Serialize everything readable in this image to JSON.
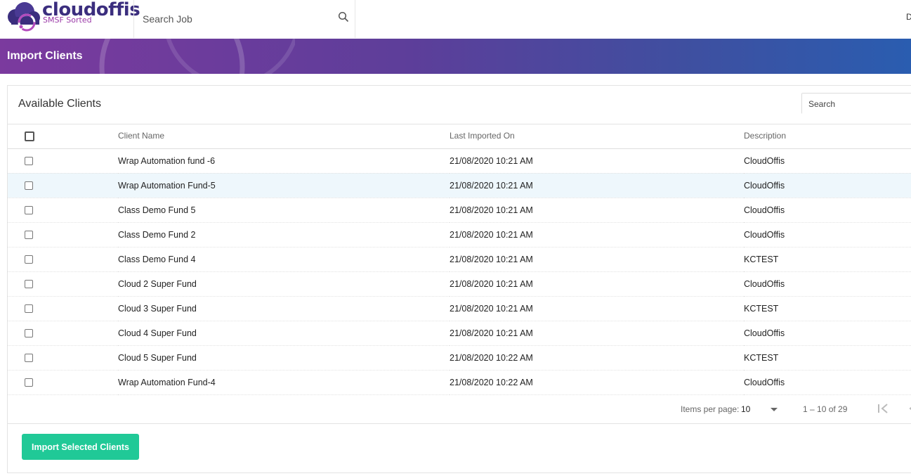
{
  "brand": {
    "name": "cloudoffis",
    "tagline": "SMSF Sorted"
  },
  "header": {
    "search_placeholder": "Search Job",
    "user_initial": "D"
  },
  "page": {
    "title": "Import Clients"
  },
  "card": {
    "title": "Available Clients",
    "search_placeholder": "Search"
  },
  "table": {
    "columns": [
      "",
      "Client Name",
      "Last Imported On",
      "Description"
    ],
    "rows": [
      {
        "name": "Wrap Automation fund -6",
        "date": "21/08/2020 10:21 AM",
        "desc": "CloudOffis"
      },
      {
        "name": "Wrap Automation Fund-5",
        "date": "21/08/2020 10:21 AM",
        "desc": "CloudOffis"
      },
      {
        "name": "Class Demo Fund 5",
        "date": "21/08/2020 10:21 AM",
        "desc": "CloudOffis"
      },
      {
        "name": "Class Demo Fund 2",
        "date": "21/08/2020 10:21 AM",
        "desc": "CloudOffis"
      },
      {
        "name": "Class Demo Fund 4",
        "date": "21/08/2020 10:21 AM",
        "desc": "KCTEST"
      },
      {
        "name": "Cloud 2 Super Fund",
        "date": "21/08/2020 10:21 AM",
        "desc": "CloudOffis"
      },
      {
        "name": "Cloud 3 Super Fund",
        "date": "21/08/2020 10:21 AM",
        "desc": "KCTEST"
      },
      {
        "name": "Cloud 4 Super Fund",
        "date": "21/08/2020 10:21 AM",
        "desc": "CloudOffis"
      },
      {
        "name": "Cloud 5 Super Fund",
        "date": "21/08/2020 10:22 AM",
        "desc": "KCTEST"
      },
      {
        "name": "Wrap Automation Fund-4",
        "date": "21/08/2020 10:22 AM",
        "desc": "CloudOffis"
      }
    ]
  },
  "paginator": {
    "items_per_page_label": "Items per page:",
    "items_per_page": "10",
    "range": "1 – 10 of 29"
  },
  "actions": {
    "import_label": "Import Selected Clients"
  },
  "colors": {
    "accent": "#20c997",
    "banner_start": "#7b3a9e",
    "banner_end": "#2a5db0",
    "brand": "#3b2e7e"
  }
}
